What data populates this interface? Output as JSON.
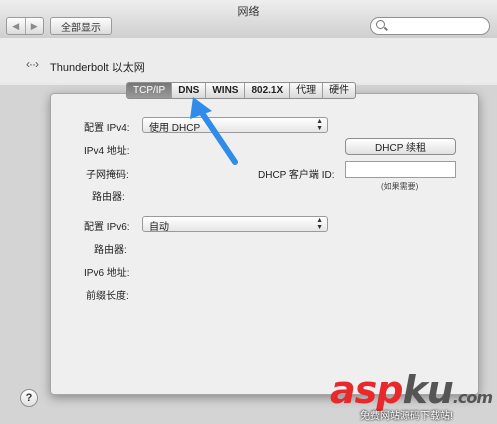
{
  "window": {
    "title": "网络"
  },
  "toolbar": {
    "back_icon": "chevron-left-icon",
    "forward_icon": "chevron-right-icon",
    "show_all": "全部显示",
    "search_placeholder": ""
  },
  "interface": {
    "icon": "thunderbolt-ethernet-icon",
    "icon_glyph": "‹··›",
    "name": "Thunderbolt 以太网"
  },
  "tabs": [
    {
      "label": "TCP/IP",
      "selected": true
    },
    {
      "label": "DNS"
    },
    {
      "label": "WINS"
    },
    {
      "label": "802.1X"
    },
    {
      "label": "代理"
    },
    {
      "label": "硬件"
    }
  ],
  "ipv4": {
    "configure_label": "配置 IPv4:",
    "configure_value": "使用 DHCP",
    "address_label": "IPv4 地址:",
    "subnet_label": "子网掩码:",
    "router_label": "路由器:",
    "renew_button": "DHCP 续租",
    "client_id_label": "DHCP 客户端 ID:",
    "client_id_value": "",
    "client_id_note": "(如果需要)"
  },
  "ipv6": {
    "configure_label": "配置 IPv6:",
    "configure_value": "自动",
    "router_label": "路由器:",
    "address_label": "IPv6 地址:",
    "prefix_label": "前缀长度:"
  },
  "help": {
    "glyph": "?"
  },
  "annotation": {
    "color": "#2f8ce8"
  },
  "watermark": {
    "logo_red": "asp",
    "logo_dark": "ku",
    "logo_tld": ".com",
    "subtitle": "免费网站源码下载站!"
  }
}
